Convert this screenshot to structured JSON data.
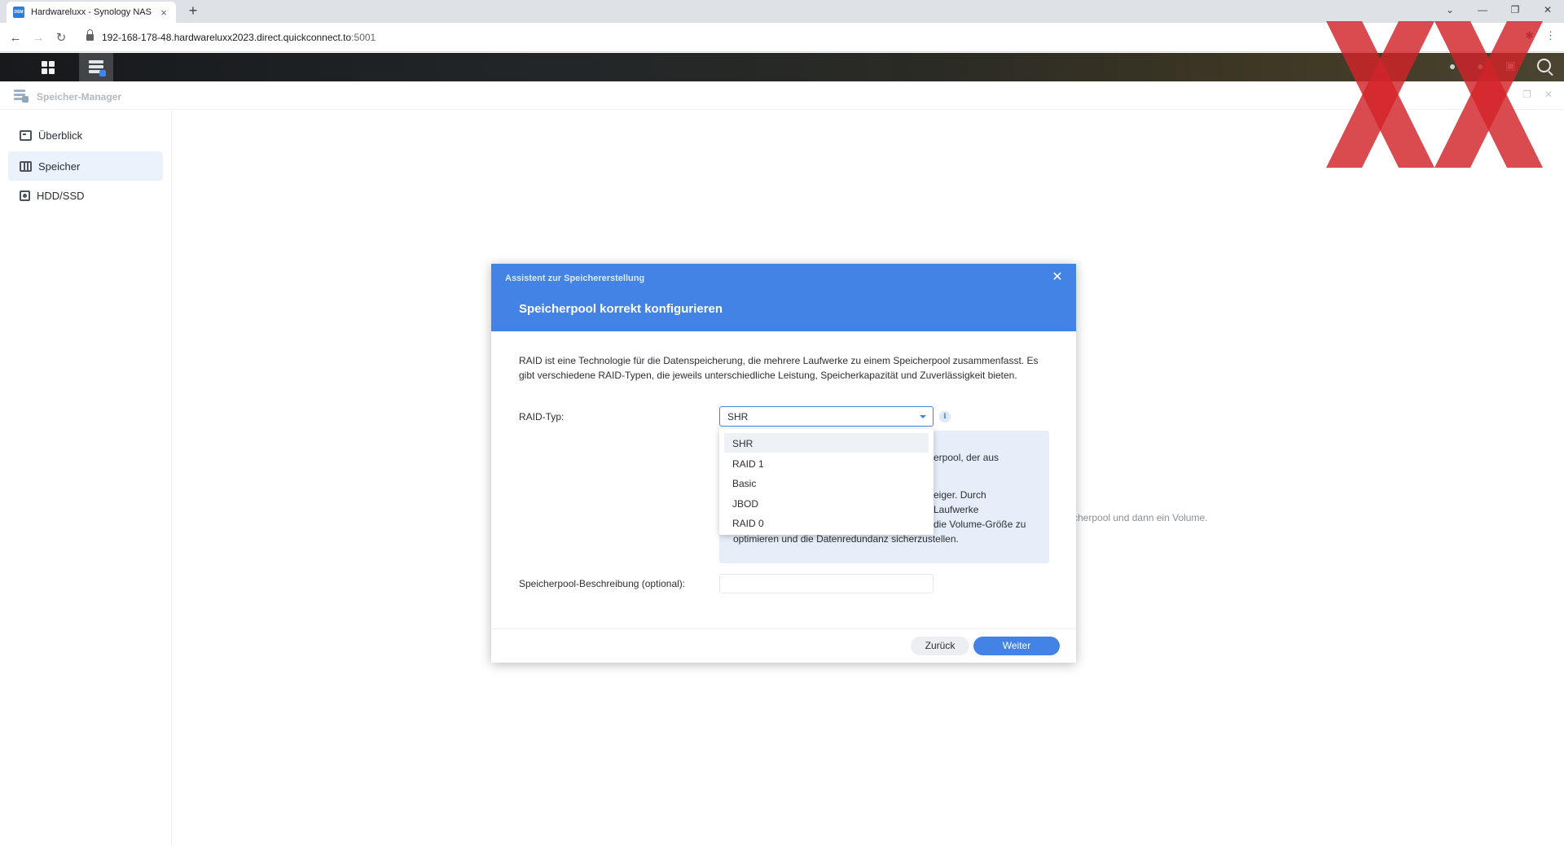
{
  "browser": {
    "tab_title": "Hardwareluxx - Synology NAS",
    "favicon_text": "DSM",
    "tab_close": "×",
    "new_tab": "+",
    "url_host": "192-168-178-48.hardwareluxx2023.direct.quickconnect.to",
    "url_port": ":5001",
    "window_controls": {
      "collapse": "⌄",
      "minimize": "—",
      "restore": "❐",
      "close": "✕"
    },
    "nav": {
      "back": "←",
      "forward": "→",
      "reload": "↻"
    },
    "menu": "⋮"
  },
  "app": {
    "title": "Speicher-Manager",
    "background_hint": "cherpool und dann ein Volume.",
    "sidebar": {
      "items": [
        {
          "label": "Überblick",
          "icon": "overview-icon",
          "active": false
        },
        {
          "label": "Speicher",
          "icon": "storage-icon",
          "active": true
        },
        {
          "label": "HDD/SSD",
          "icon": "hdd-icon",
          "active": false
        }
      ]
    }
  },
  "wizard": {
    "window_title": "Assistent zur Speichererstellung",
    "close": "✕",
    "heading": "Speicherpool korrekt konfigurieren",
    "description": "RAID ist eine Technologie für die Datenspeicherung, die mehrere Laufwerke zu einem Speicherpool zusammenfasst. Es gibt verschiedene RAID-Typen, die jeweils unterschiedliche Leistung, Speicherkapazität und Zuverlässigkeit bieten.",
    "raid_label": "RAID-Typ:",
    "raid_value": "SHR",
    "info_icon": "i",
    "raid_options": [
      "SHR",
      "RAID 1",
      "Basic",
      "JBOD",
      "RAID 0"
    ],
    "selected_option": "SHR",
    "info_lines": [
      "erpool, der aus",
      "eiger. Durch",
      "Laufwerke",
      "die Volume-Größe zu",
      "optimieren und die Datenredundanz sicherzustellen."
    ],
    "description_label": "Speicherpool-Beschreibung (optional):",
    "description_value": "",
    "back_button": "Zurück",
    "next_button": "Weiter"
  },
  "colors": {
    "accent": "#4483e6",
    "watermark": "#d2232a"
  }
}
